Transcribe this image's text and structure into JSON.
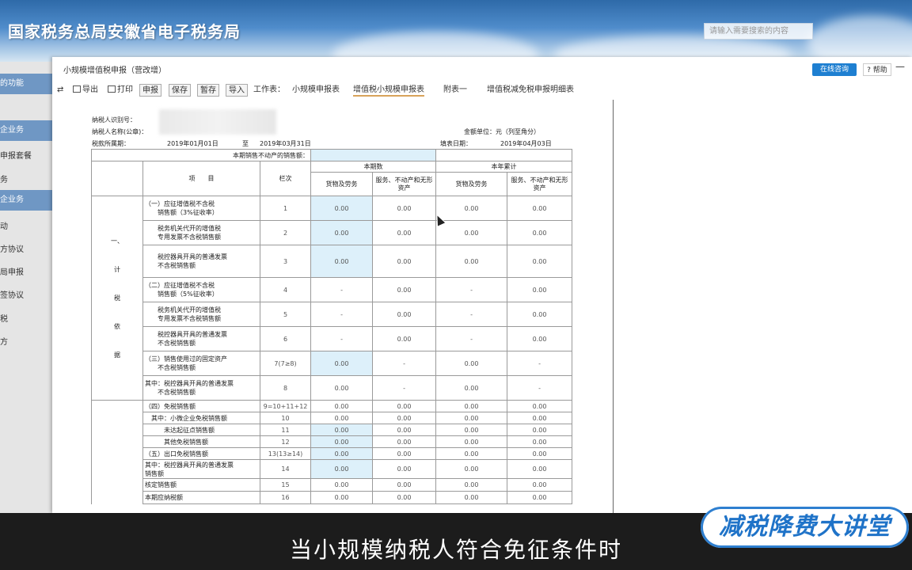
{
  "site": {
    "title": "国家税务总局安徽省电子税务局",
    "search_placeholder": "请输入需要搜索的内容",
    "side_items": [
      "的功能",
      "企业务",
      "申报套餐",
      "务",
      "企业务",
      "动",
      "方协议",
      "局申报",
      "签协议",
      "税",
      "方"
    ]
  },
  "modal": {
    "title": "小规模增值税申报（营改增）",
    "online_label": "在线咨询",
    "help_label": "? 帮助",
    "min_label": "—",
    "toolbar": {
      "export": "导出",
      "print": "打印",
      "declare": "申报",
      "save": "保存",
      "temp_save": "暂存",
      "import": "导入",
      "worksheet_label": "工作表：",
      "tabs": [
        "小规模申报表",
        "增值税小规模申报表",
        "附表一",
        "增值税减免税申报明细表"
      ],
      "active_tab": 1
    }
  },
  "form": {
    "taxpayer_id_label": "纳税人识别号：",
    "taxpayer_name_label": "纳税人名称(公章)：",
    "amount_unit_label": "金额单位：元（列至角分）",
    "period_label": "税款所属期：",
    "period_start": "2019年01月01日",
    "period_to": "至",
    "period_end": "2019年03月31日",
    "fill_date_label": "填表日期：",
    "fill_date": "2019年04月03日",
    "real_estate_label": "本期销售不动产的销售额：",
    "col_headers": {
      "item": "项　　目",
      "line": "栏次",
      "current": "本期数",
      "ytd": "本年累计",
      "goods": "货物及劳务",
      "services": "服务、不动产和无形资产"
    },
    "section_chars": [
      "一、",
      "计",
      "税",
      "依",
      "据"
    ],
    "rows": [
      {
        "label": "（一）应征增值税不含税\n　　销售额（3%征收率）",
        "line": "1",
        "v": [
          "0.00",
          "0.00",
          "0.00",
          "0.00"
        ],
        "blue": true
      },
      {
        "label": "　　税务机关代开的增值税\n　　专用发票不含税销售额",
        "line": "2",
        "v": [
          "0.00",
          "0.00",
          "0.00",
          "0.00"
        ],
        "blue": true
      },
      {
        "label": "　　税控器具开具的普通发票\n　　不含税销售额",
        "line": "3",
        "v": [
          "0.00",
          "0.00",
          "0.00",
          "0.00"
        ],
        "blue": true
      },
      {
        "label": "（二）应征增值税不含税\n　　销售额（5%征收率）",
        "line": "4",
        "v": [
          "-",
          "0.00",
          "-",
          "0.00"
        ],
        "blue": false
      },
      {
        "label": "　　税务机关代开的增值税\n　　专用发票不含税销售额",
        "line": "5",
        "v": [
          "-",
          "0.00",
          "-",
          "0.00"
        ],
        "blue": false
      },
      {
        "label": "　　税控器具开具的普通发票\n　　不含税销售额",
        "line": "6",
        "v": [
          "-",
          "0.00",
          "-",
          "0.00"
        ],
        "blue": false
      },
      {
        "label": "（三）销售使用过的固定资产\n　　不含税销售额",
        "line": "7(7≥8)",
        "v": [
          "0.00",
          "-",
          "0.00",
          "-"
        ],
        "blue": true
      },
      {
        "label": "其中：税控器具开具的普通发票\n　　不含税销售额",
        "line": "8",
        "v": [
          "0.00",
          "-",
          "0.00",
          "-"
        ],
        "blue": false
      },
      {
        "label": "（四）免税销售额",
        "line": "9=10+11+12",
        "v": [
          "0.00",
          "0.00",
          "0.00",
          "0.00"
        ],
        "blue": false
      },
      {
        "label": "　其中：小微企业免税销售额",
        "line": "10",
        "v": [
          "0.00",
          "0.00",
          "0.00",
          "0.00"
        ],
        "blue": false
      },
      {
        "label": "　　　未达起征点销售额",
        "line": "11",
        "v": [
          "0.00",
          "0.00",
          "0.00",
          "0.00"
        ],
        "blue": true
      },
      {
        "label": "　　　其他免税销售额",
        "line": "12",
        "v": [
          "0.00",
          "0.00",
          "0.00",
          "0.00"
        ],
        "blue": true
      },
      {
        "label": "（五）出口免税销售额",
        "line": "13(13≥14)",
        "v": [
          "0.00",
          "0.00",
          "0.00",
          "0.00"
        ],
        "blue": true
      },
      {
        "label": "其中：税控器具开具的普通发票\n销售额",
        "line": "14",
        "v": [
          "0.00",
          "0.00",
          "0.00",
          "0.00"
        ],
        "blue": true
      },
      {
        "label": "核定销售额",
        "line": "15",
        "v": [
          "0.00",
          "0.00",
          "0.00",
          "0.00"
        ],
        "blue": false
      },
      {
        "label": "本期应纳税额",
        "line": "16",
        "v": [
          "0.00",
          "0.00",
          "0.00",
          "0.00"
        ],
        "blue": false
      }
    ]
  },
  "overlay": {
    "subtitle": "当小规模纳税人符合免征条件时",
    "badge": "减税降费大讲堂"
  }
}
